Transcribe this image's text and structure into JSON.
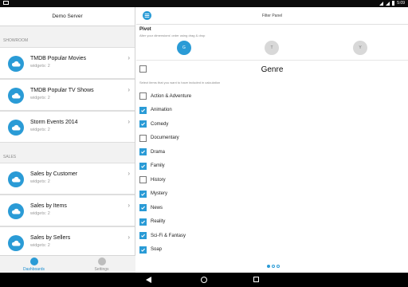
{
  "status_bar": {
    "time": "5:09",
    "left_icon": "notification-icon",
    "icons": [
      "wifi-icon",
      "signal-icon",
      "battery-icon"
    ]
  },
  "left_panel": {
    "title": "Demo Server",
    "sections": [
      {
        "label": "SHOWROOM",
        "items": [
          {
            "title": "TMDB Popular Movies",
            "subtitle": "widgets: 2"
          },
          {
            "title": "TMDB Popular TV Shows",
            "subtitle": "widgets: 2"
          },
          {
            "title": "Storm Events 2014",
            "subtitle": "widgets: 2"
          }
        ]
      },
      {
        "label": "SALES",
        "items": [
          {
            "title": "Sales by Customer",
            "subtitle": "widgets: 2"
          },
          {
            "title": "Sales by Items",
            "subtitle": "widgets: 2"
          },
          {
            "title": "Sales by Sellers",
            "subtitle": "widgets: 2"
          }
        ]
      }
    ],
    "tabs": [
      {
        "label": "Dashboards",
        "active": true
      },
      {
        "label": "Settings",
        "active": false
      }
    ]
  },
  "filter_panel": {
    "title": "Filter Panel",
    "pivot_title": "Pivot",
    "pivot_hint": "Alter your dimensions' order using drag & drop",
    "pivot_dimensions": [
      {
        "label": "G",
        "active": true
      },
      {
        "label": "T",
        "active": false
      },
      {
        "label": "Y",
        "active": false
      }
    ],
    "dimension_name": "Genre",
    "select_hint": "Select items that you want to have included in calculation",
    "items": [
      {
        "label": "Action & Adventure",
        "checked": false
      },
      {
        "label": "Animation",
        "checked": true
      },
      {
        "label": "Comedy",
        "checked": true
      },
      {
        "label": "Documentary",
        "checked": false
      },
      {
        "label": "Drama",
        "checked": true
      },
      {
        "label": "Family",
        "checked": true
      },
      {
        "label": "History",
        "checked": false
      },
      {
        "label": "Mystery",
        "checked": true
      },
      {
        "label": "News",
        "checked": true
      },
      {
        "label": "Reality",
        "checked": true
      },
      {
        "label": "Sci-Fi & Fantasy",
        "checked": true
      },
      {
        "label": "Soap",
        "checked": true
      }
    ],
    "page_dots": {
      "count": 3,
      "current": 1
    }
  },
  "colors": {
    "accent": "#2a9bd6",
    "panel_bg": "#f2f2f2"
  }
}
